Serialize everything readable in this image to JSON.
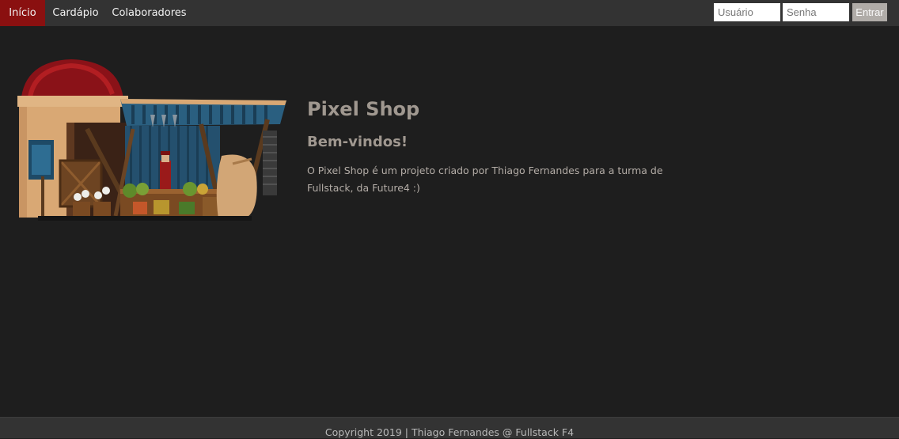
{
  "nav": {
    "items": [
      {
        "label": "Início",
        "active": true
      },
      {
        "label": "Cardápio",
        "active": false
      },
      {
        "label": "Colaboradores",
        "active": false
      }
    ],
    "login": {
      "user_placeholder": "Usuário",
      "pass_placeholder": "Senha",
      "submit_label": "Entrar"
    }
  },
  "main": {
    "title": "Pixel Shop",
    "subtitle": "Bem-vindos!",
    "description": "O Pixel Shop é um projeto criado por Thiago Fernandes para a turma de Fullstack, da Future4 :)"
  },
  "footer": {
    "text": "Copyright 2019 | Thiago Fernandes @ Fullstack F4"
  },
  "colors": {
    "nav_bg": "#333333",
    "nav_active": "#8a1010",
    "page_bg": "#1e1e1e",
    "heading": "#a09890",
    "button_bg": "#b0aca8"
  },
  "icons": [
    "market-stall-image"
  ]
}
